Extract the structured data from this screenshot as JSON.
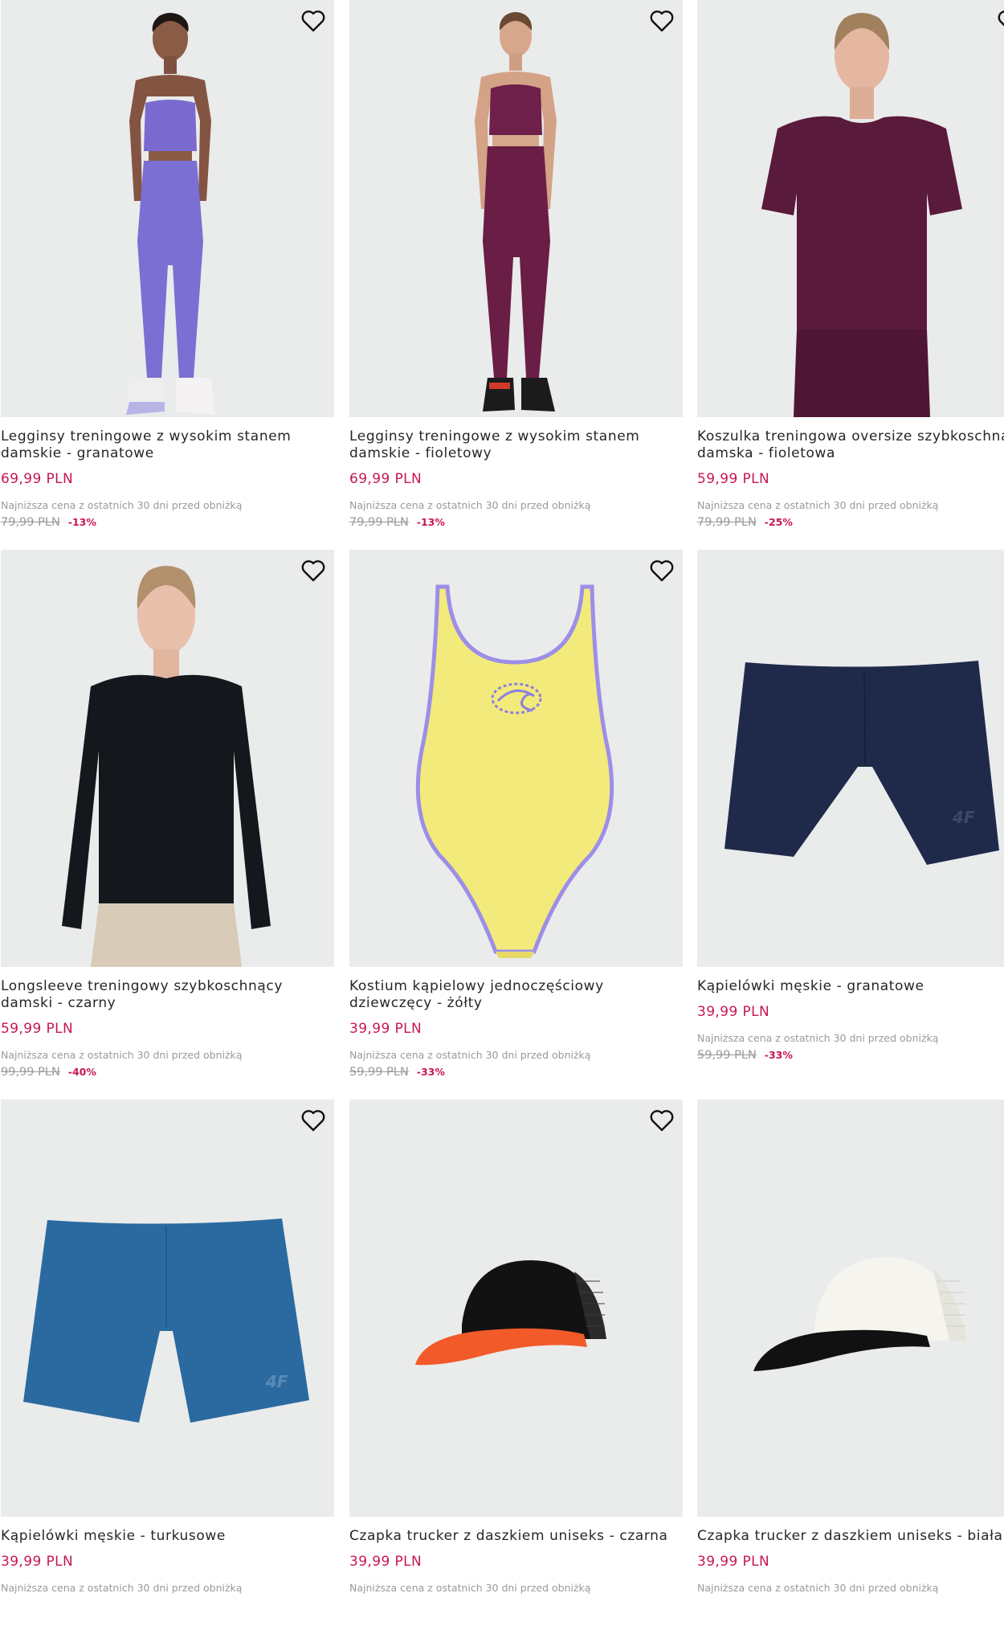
{
  "colors": {
    "price": "#c8174f",
    "muted": "#9a9a9a",
    "image_bg": "#eaebeb",
    "title": "#262626"
  },
  "products": [
    {
      "title": "Legginsy treningowe z wysokim stanem damskie - granatowe",
      "price": "69,99 PLN",
      "lowest_label": "Najniższa cena z ostatnich 30 dni przed obniżką",
      "old_price": "79,99 PLN",
      "discount": "-13%",
      "image_icon": "leggings-woman-lavender-image",
      "wishlist_icon": "heart-icon"
    },
    {
      "title": "Legginsy treningowe z wysokim stanem damskie - fioletowy",
      "price": "69,99 PLN",
      "lowest_label": "Najniższa cena z ostatnich 30 dni przed obniżką",
      "old_price": "79,99 PLN",
      "discount": "-13%",
      "image_icon": "leggings-woman-plum-image",
      "wishlist_icon": "heart-icon"
    },
    {
      "title": "Koszulka treningowa oversize szybkoschnąca damska - fioletowa",
      "price": "59,99 PLN",
      "lowest_label": "Najniższa cena z ostatnich 30 dni przed obniżką",
      "old_price": "79,99 PLN",
      "discount": "-25%",
      "image_icon": "tshirt-woman-plum-image",
      "wishlist_icon": "heart-icon"
    },
    {
      "title": "Longsleeve treningowy szybkoschnący damski - czarny",
      "price": "59,99 PLN",
      "lowest_label": "Najniższa cena z ostatnich 30 dni przed obniżką",
      "old_price": "99,99 PLN",
      "discount": "-40%",
      "image_icon": "longsleeve-woman-black-image",
      "wishlist_icon": "heart-icon"
    },
    {
      "title": "Kostium kąpielowy jednoczęściowy dziewczęcy - żółty",
      "price": "39,99 PLN",
      "lowest_label": "Najniższa cena z ostatnich 30 dni przed obniżką",
      "old_price": "59,99 PLN",
      "discount": "-33%",
      "image_icon": "swimsuit-yellow-image",
      "wishlist_icon": "heart-icon"
    },
    {
      "title": "Kąpielówki męskie - granatowe",
      "price": "39,99 PLN",
      "lowest_label": "Najniższa cena z ostatnich 30 dni przed obniżką",
      "old_price": "59,99 PLN",
      "discount": "-33%",
      "image_icon": "swim-shorts-navy-image",
      "wishlist_icon": "heart-icon"
    },
    {
      "title": "Kąpielówki męskie - turkusowe",
      "price": "39,99 PLN",
      "lowest_label": "Najniższa cena z ostatnich 30 dni przed obniżką",
      "image_icon": "swim-shorts-turquoise-image",
      "wishlist_icon": "heart-icon"
    },
    {
      "title": "Czapka trucker z daszkiem uniseks - czarna",
      "price": "39,99 PLN",
      "lowest_label": "Najniższa cena z ostatnich 30 dni przed obniżką",
      "image_icon": "cap-black-orange-image",
      "wishlist_icon": "heart-icon"
    },
    {
      "title": "Czapka trucker z daszkiem uniseks - biała",
      "price": "39,99 PLN",
      "lowest_label": "Najniższa cena z ostatnich 30 dni przed obniżką",
      "image_icon": "cap-white-black-image",
      "wishlist_icon": "heart-icon"
    }
  ]
}
